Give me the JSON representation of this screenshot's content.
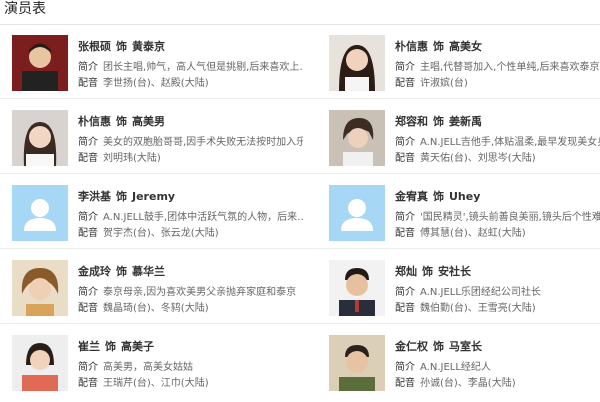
{
  "section_title": "演员表",
  "cast": [
    {
      "actor": "张根硕",
      "verb": "饰",
      "role": "黄泰京",
      "intro_label": "简介",
      "intro": "团长主唱,帅气，高人气但是挑剔,后来喜欢上…",
      "dub_label": "配音",
      "dub": "李世扬(台)、赵殿(大陆)",
      "photo": "photo"
    },
    {
      "actor": "朴信惠",
      "verb": "饰",
      "role": "高美女",
      "intro_label": "简介",
      "intro": "主唱,代替哥加入,个性单纯,后来喜欢泰京",
      "dub_label": "配音",
      "dub": "许淑嫔(台)",
      "photo": "photo"
    },
    {
      "actor": "朴信惠",
      "verb": "饰",
      "role": "高美男",
      "intro_label": "简介",
      "intro": "美女的双胞胎哥哥,因手术失败无法按时加入乐队",
      "dub_label": "配音",
      "dub": "刘明玮(大陆)",
      "photo": "photo"
    },
    {
      "actor": "郑容和",
      "verb": "饰",
      "role": "姜新禹",
      "intro_label": "简介",
      "intro": "A.N.JELL吉他手,体贴温柔,最早发现美女身份",
      "dub_label": "配音",
      "dub": "黄天佑(台)、刘思岑(大陆)",
      "photo": "photo"
    },
    {
      "actor": "李洪基",
      "verb": "饰",
      "role": "Jeremy",
      "intro_label": "简介",
      "intro": "A.N.JELL鼓手,团体中活跃气氛的人物，后来…",
      "dub_label": "配音",
      "dub": "贺宇杰(台)、张云龙(大陆)",
      "photo": "placeholder"
    },
    {
      "actor": "金宥真",
      "verb": "饰",
      "role": "Uhey",
      "intro_label": "简介",
      "intro": "'国民精灵',镜头前善良美丽,镜头后个性难搞,…",
      "dub_label": "配音",
      "dub": "傅其慧(台)、赵虹(大陆)",
      "photo": "placeholder"
    },
    {
      "actor": "金成玲",
      "verb": "饰",
      "role": "慕华兰",
      "intro_label": "简介",
      "intro": "泰京母亲,因为喜欢美男父亲抛弃家庭和泰京",
      "dub_label": "配音",
      "dub": "魏晶琦(台)、冬鸫(大陆)",
      "photo": "photo"
    },
    {
      "actor": "郑灿",
      "verb": "饰",
      "role": "安社长",
      "intro_label": "简介",
      "intro": "A.N.JELL乐团经纪公司社长",
      "dub_label": "配音",
      "dub": "魏伯勤(台)、王雪亮(大陆)",
      "photo": "photo"
    },
    {
      "actor": "崔兰",
      "verb": "饰",
      "role": "高美子",
      "intro_label": "简介",
      "intro": "高美男，高美女姑姑",
      "dub_label": "配音",
      "dub": "王瑞芹(台)、江巾(大陆)",
      "photo": "photo"
    },
    {
      "actor": "金仁权",
      "verb": "饰",
      "role": "马室长",
      "intro_label": "简介",
      "intro": "A.N.JELL经纪人",
      "dub_label": "配音",
      "dub": "孙诚(台)、李晶(大陆)",
      "photo": "photo"
    }
  ]
}
